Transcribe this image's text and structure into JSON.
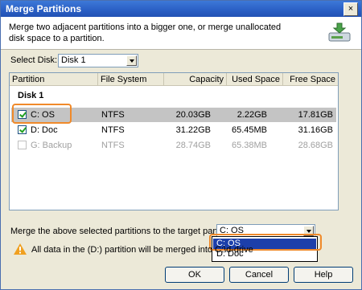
{
  "window": {
    "title": "Merge Partitions",
    "close_glyph": "×"
  },
  "header": {
    "description": "Merge two adjacent partitions into a bigger one, or merge unallocated disk space to a partition.",
    "icon": "merge-disk-icon"
  },
  "disk_select": {
    "label": "Select Disk:",
    "value": "Disk 1"
  },
  "table": {
    "columns": [
      "Partition",
      "File System",
      "Capacity",
      "Used Space",
      "Free Space"
    ],
    "disk_label": "Disk 1",
    "rows": [
      {
        "partition": "C:  OS",
        "fs": "NTFS",
        "capacity": "20.03GB",
        "used": "2.22GB",
        "free": "17.81GB",
        "checked": true,
        "selected": true,
        "disabled": false
      },
      {
        "partition": "D:  Doc",
        "fs": "NTFS",
        "capacity": "31.22GB",
        "used": "65.45MB",
        "free": "31.16GB",
        "checked": true,
        "selected": false,
        "disabled": false
      },
      {
        "partition": "G:  Backup",
        "fs": "NTFS",
        "capacity": "28.74GB",
        "used": "65.38MB",
        "free": "28.68GB",
        "checked": false,
        "selected": false,
        "disabled": true
      }
    ]
  },
  "target": {
    "label": "Merge the above selected partitions to the target partition:",
    "value": "C:  OS",
    "options": [
      "C:  OS",
      "D:  Doc"
    ]
  },
  "warning": {
    "text": "All data in the (D:) partition will be merged into C:\\d-drive"
  },
  "buttons": {
    "ok": "OK",
    "cancel": "Cancel",
    "help": "Help"
  },
  "colors": {
    "title_bar": "#2a5fc4",
    "highlight": "#1c3faa",
    "callout": "#f08a2a",
    "checkmark": "#21a121"
  }
}
